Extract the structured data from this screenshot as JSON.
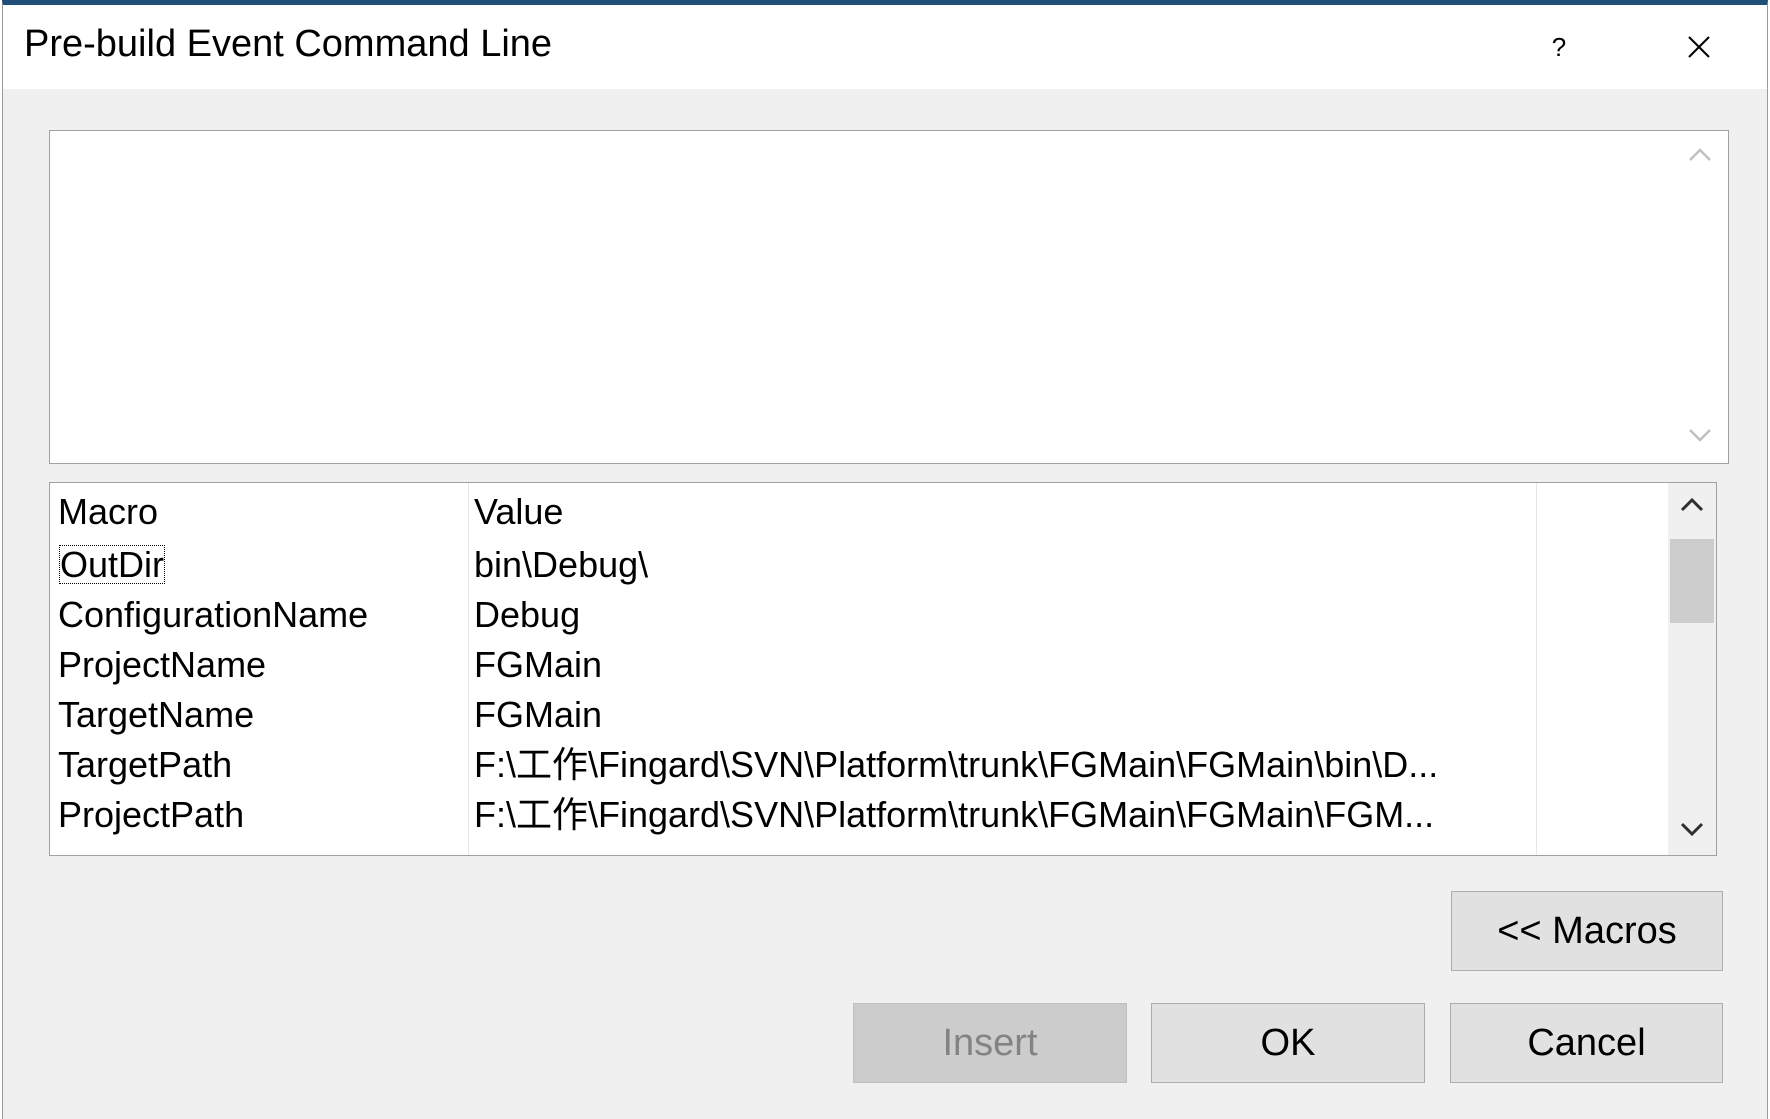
{
  "dialog": {
    "title": "Pre-build Event Command Line",
    "help_label": "?",
    "command_text": ""
  },
  "macro_table": {
    "columns": {
      "macro": "Macro",
      "value": "Value"
    },
    "rows": [
      {
        "macro": "OutDir",
        "value": "bin\\Debug\\"
      },
      {
        "macro": "ConfigurationName",
        "value": "Debug"
      },
      {
        "macro": "ProjectName",
        "value": "FGMain"
      },
      {
        "macro": "TargetName",
        "value": "FGMain"
      },
      {
        "macro": "TargetPath",
        "value": "F:\\工作\\Fingard\\SVN\\Platform\\trunk\\FGMain\\FGMain\\bin\\D..."
      },
      {
        "macro": "ProjectPath",
        "value": "F:\\工作\\Fingard\\SVN\\Platform\\trunk\\FGMain\\FGMain\\FGM..."
      }
    ],
    "selected_row": 0
  },
  "buttons": {
    "macros_label": "<< Macros",
    "insert_label": "Insert",
    "ok_label": "OK",
    "cancel_label": "Cancel"
  },
  "icons": {
    "close": "close-icon",
    "scroll_up": "chevron-up-icon",
    "scroll_down": "chevron-down-icon"
  },
  "colors": {
    "title_accent": "#1f4e79",
    "dialog_bg": "#f0f0f0",
    "button_bg": "#e1e1e1",
    "disabled_text": "#838383"
  }
}
